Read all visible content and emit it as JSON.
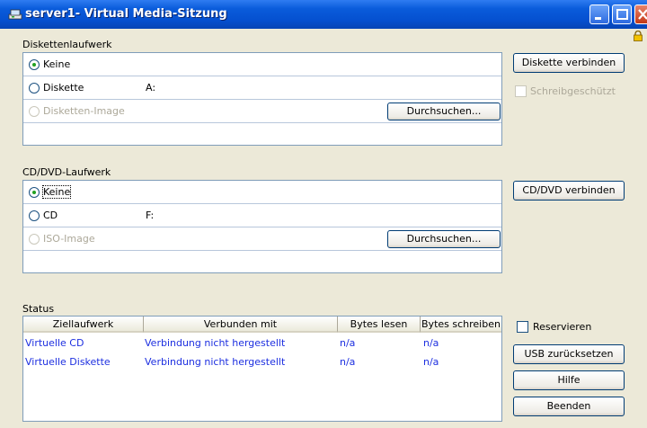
{
  "window": {
    "title": "server1- Virtual Media-Sitzung"
  },
  "floppy": {
    "section_label": "Diskettenlaufwerk",
    "options": [
      {
        "label": "Keine",
        "checked": true,
        "disabled": false
      },
      {
        "label": "Diskette",
        "checked": false,
        "disabled": false,
        "drive": "A:"
      },
      {
        "label": "Disketten-Image",
        "checked": false,
        "disabled": true
      }
    ],
    "browse_label": "Durchsuchen...",
    "connect_label": "Diskette verbinden",
    "write_protect_label": "Schreibgeschützt"
  },
  "cd": {
    "section_label": "CD/DVD-Laufwerk",
    "options": [
      {
        "label": "Keine",
        "checked": true,
        "disabled": false
      },
      {
        "label": "CD",
        "checked": false,
        "disabled": false,
        "drive": "F:"
      },
      {
        "label": "ISO-Image",
        "checked": false,
        "disabled": true
      }
    ],
    "browse_label": "Durchsuchen...",
    "connect_label": "CD/DVD verbinden"
  },
  "status": {
    "section_label": "Status",
    "columns": [
      "Ziellaufwerk",
      "Verbunden mit",
      "Bytes lesen",
      "Bytes schreiben"
    ],
    "rows": [
      [
        "Virtuelle CD",
        "Verbindung nicht hergestellt",
        "n/a",
        "n/a"
      ],
      [
        "Virtuelle Diskette",
        "Verbindung nicht hergestellt",
        "n/a",
        "n/a"
      ]
    ]
  },
  "actions": {
    "reserve_label": "Reservieren",
    "usb_reset_label": "USB zurücksetzen",
    "help_label": "Hilfe",
    "exit_label": "Beenden"
  },
  "colors": {
    "titlebar": "#0A5CDB",
    "status_text": "#1D2FE0",
    "window_bg": "#ECE9D8"
  }
}
